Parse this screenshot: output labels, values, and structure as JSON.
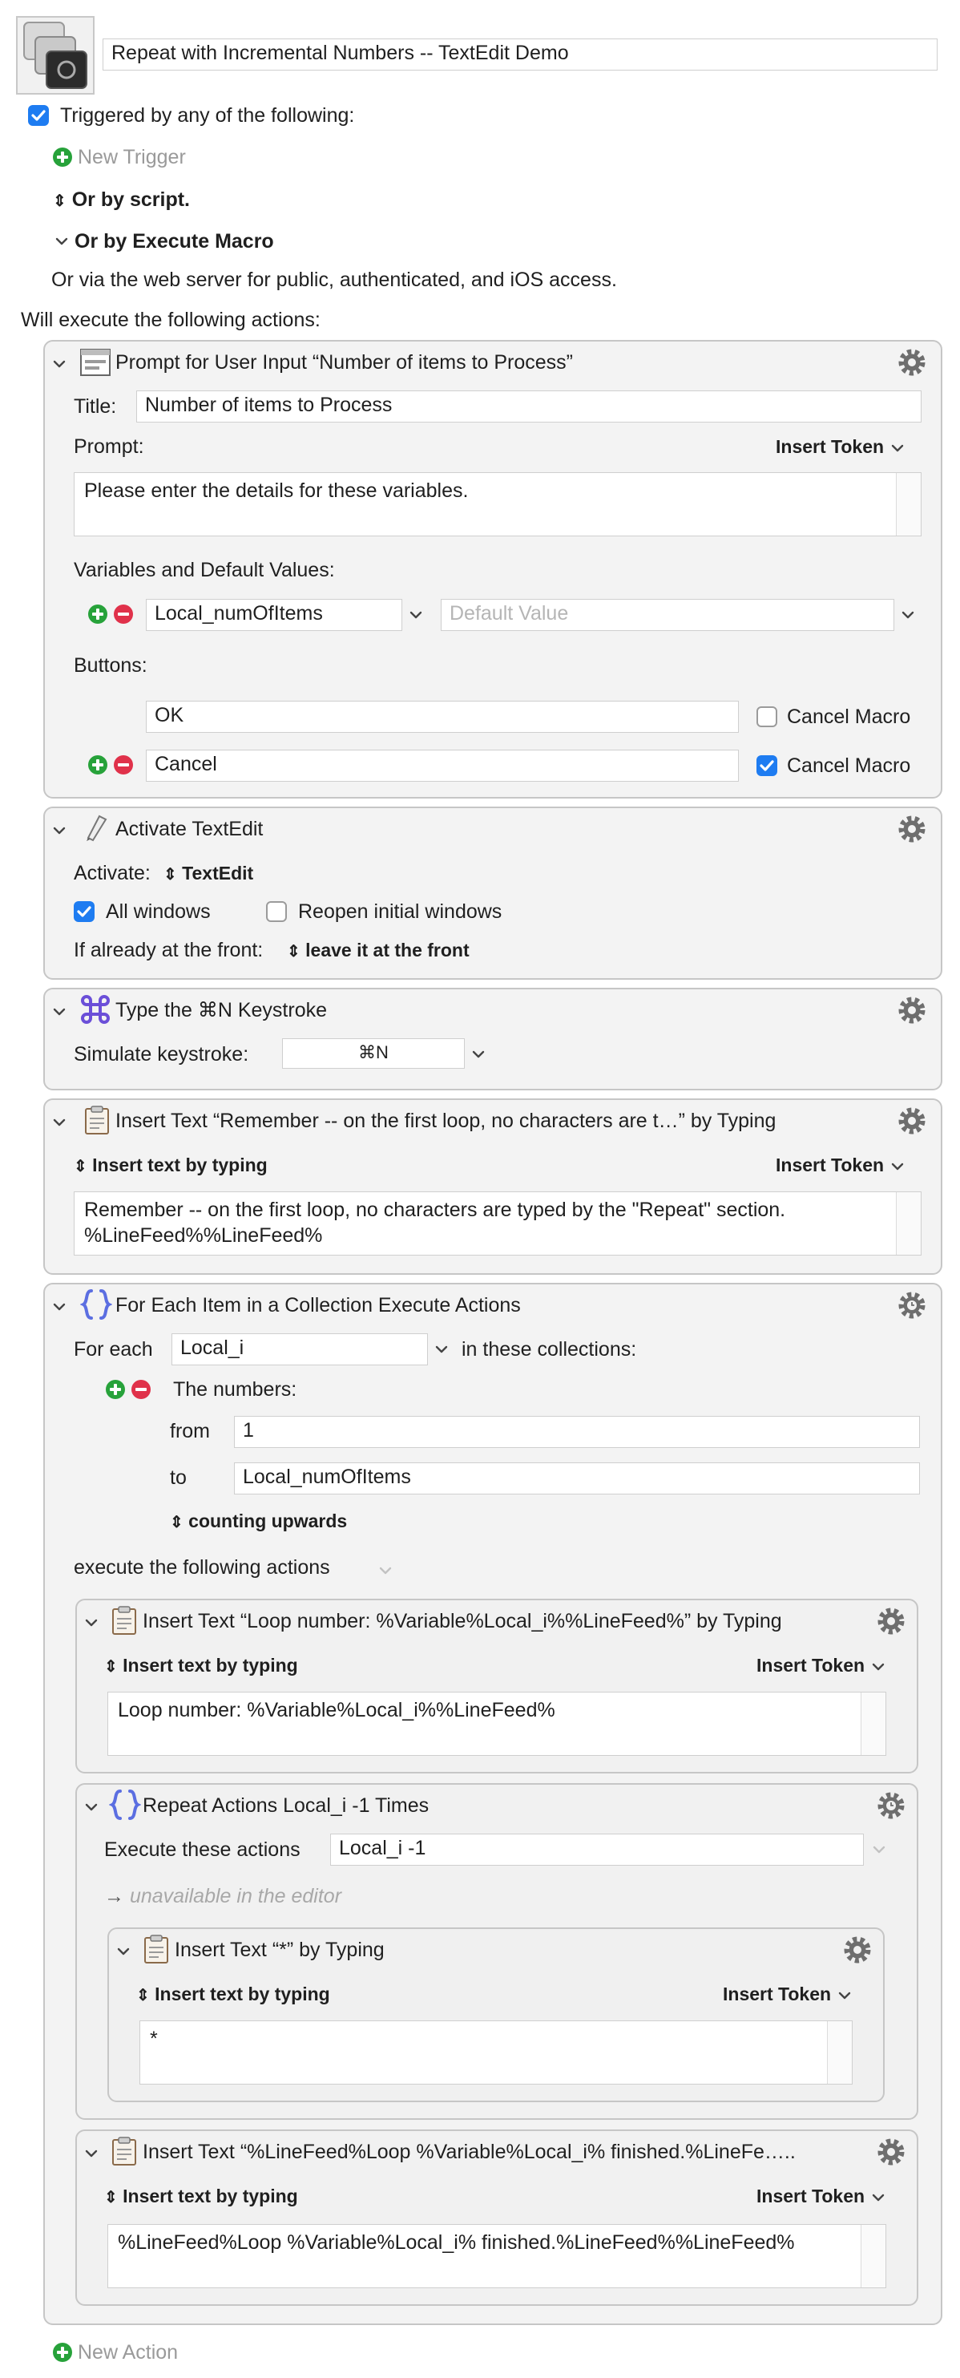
{
  "macro": {
    "name": "Repeat with Incremental Numbers -- TextEdit Demo",
    "triggered_label": "Triggered by any of the following:",
    "new_trigger": "New Trigger",
    "or_by_script": "Or by script.",
    "or_by_execute_macro": "Or by Execute Macro",
    "web_server_note": "Or via the web server for public, authenticated, and iOS access.",
    "will_execute": "Will execute the following actions:",
    "new_action": "New Action"
  },
  "prompt_action": {
    "title": "Prompt for User Input “Number of items to Process”",
    "title_label": "Title:",
    "title_value": "Number of items to Process",
    "prompt_label": "Prompt:",
    "insert_token": "Insert Token",
    "prompt_text": "Please enter the details for these variables.",
    "vars_label": "Variables and Default Values:",
    "var_name": "Local_numOfItems",
    "default_placeholder": "Default Value",
    "buttons_label": "Buttons:",
    "button1": "OK",
    "button2": "Cancel",
    "cancel_macro": "Cancel Macro",
    "button1_cancel": false,
    "button2_cancel": true
  },
  "activate_action": {
    "title": "Activate TextEdit",
    "activate_label": "Activate:",
    "app": "TextEdit",
    "all_windows": "All windows",
    "reopen": "Reopen initial windows",
    "front_label": "If already at the front:",
    "front_value": "leave it at the front"
  },
  "keystroke_action": {
    "title": "Type the ⌘N Keystroke",
    "simulate_label": "Simulate keystroke:",
    "keystroke": "⌘N"
  },
  "insert_remember": {
    "title": "Insert Text “Remember -- on the first loop, no characters are t…” by Typing",
    "mode": "Insert text by typing",
    "insert_token": "Insert Token",
    "line1": "Remember -- on the first loop, no characters are typed by the \"Repeat\" section.",
    "line2": "%LineFeed%%LineFeed%"
  },
  "for_each": {
    "title": "For Each Item in a Collection Execute Actions",
    "for_each_label": "For each",
    "variable": "Local_i",
    "in_collections": "in these collections:",
    "numbers_label": "The numbers:",
    "from_label": "from",
    "from_value": "1",
    "to_label": "to",
    "to_value": "Local_numOfItems",
    "counting": "counting upwards",
    "execute_label": "execute the following actions"
  },
  "loop_text": {
    "title": "Insert Text “Loop number: %Variable%Local_i%%LineFeed%” by Typing",
    "mode": "Insert text by typing",
    "insert_token": "Insert Token",
    "text": "Loop number: %Variable%Local_i%%LineFeed%"
  },
  "repeat_action": {
    "title": "Repeat Actions Local_i -1  Times",
    "execute_label": "Execute these actions",
    "count": "Local_i -1",
    "unavailable": "unavailable in the editor"
  },
  "star_text": {
    "title": "Insert Text “*” by Typing",
    "mode": "Insert text by typing",
    "insert_token": "Insert Token",
    "text": "*"
  },
  "finished_text": {
    "title": "Insert Text “%LineFeed%Loop %Variable%Local_i% finished.%LineFe…..",
    "mode": "Insert text by typing",
    "insert_token": "Insert Token",
    "text": "%LineFeed%Loop %Variable%Local_i% finished.%LineFeed%%LineFeed%"
  },
  "colors": {
    "accent": "#1e7cf1",
    "add_green": "#27a23a",
    "remove_red": "#e0314a",
    "panel_bg": "#f3f3f3",
    "border": "#c6c6c6"
  }
}
